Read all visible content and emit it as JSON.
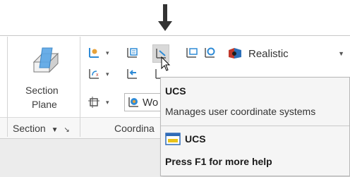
{
  "section_panel": {
    "button_label_line1": "Section",
    "button_label_line2": "Plane",
    "panel_title": "Section",
    "panel_title_arrow": "▼",
    "launcher": "↘"
  },
  "coordinates_panel": {
    "panel_title": "Coordina",
    "ucs_combo_value": "Wo"
  },
  "visual_style": {
    "selected": "Realistic",
    "arrow": "▼"
  },
  "tooltip": {
    "title": "UCS",
    "description": "Manages user coordinate systems",
    "command_name": "UCS",
    "help_text": "Press F1 for more help"
  },
  "icons": [
    "down-arrow-indicator-icon",
    "section-plane-icon",
    "ucs-world-icon",
    "ucs-named-icon",
    "ucs-origin-icon",
    "ucs-3point-icon",
    "ucs-view-icon",
    "ucs-x-icon",
    "ucs-previous-icon",
    "ucs-z-icon",
    "ucs-object-icon",
    "ucs-globe-icon",
    "realistic-style-icon",
    "mouse-cursor-icon",
    "ucs-command-icon"
  ],
  "colors": {
    "accent_blue": "#2f8bd6",
    "orange": "#e8a23a",
    "tooltip_bg": "#f5f5f5"
  }
}
